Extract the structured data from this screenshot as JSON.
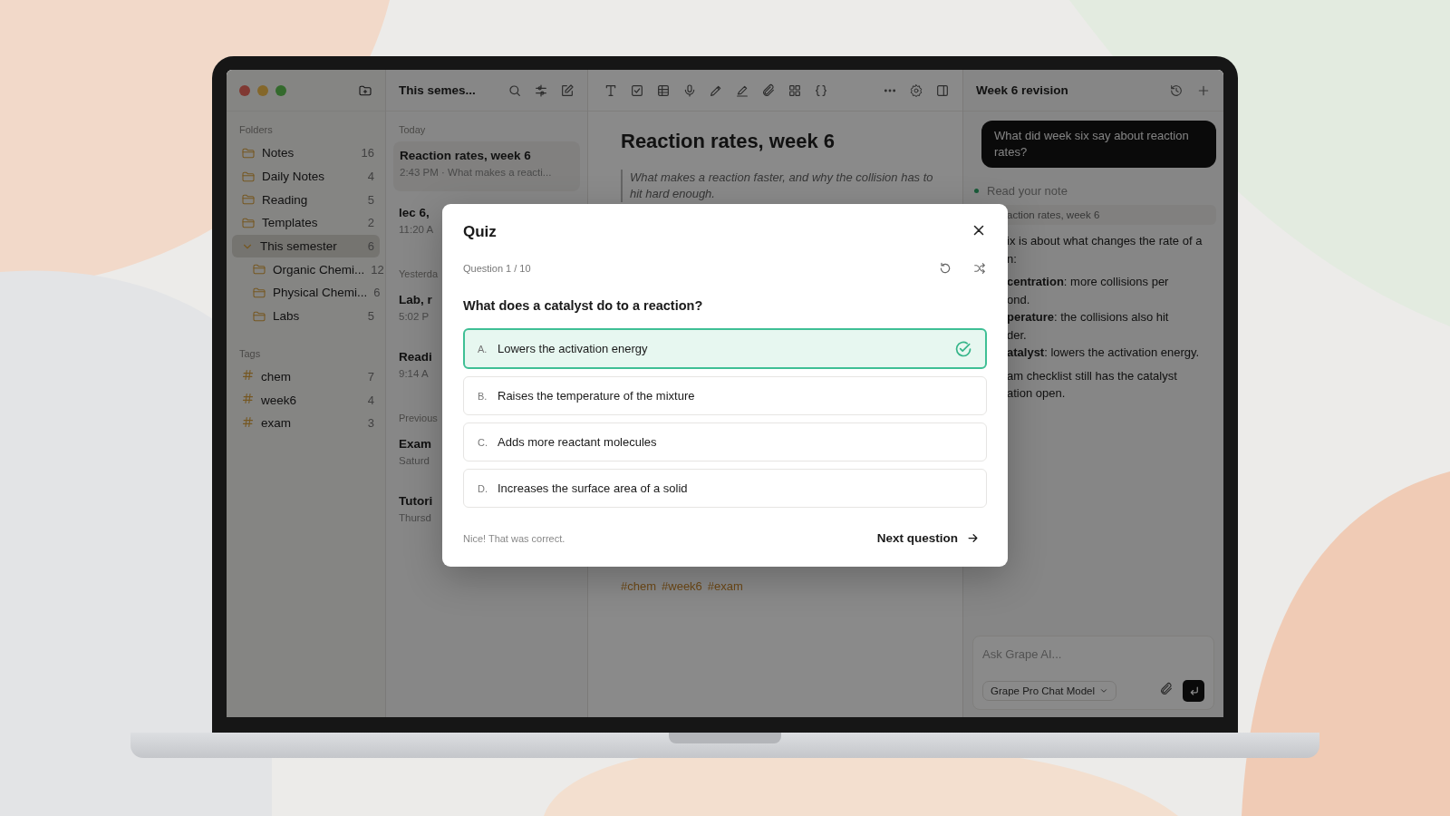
{
  "sidebar": {
    "folders_heading": "Folders",
    "folders": [
      {
        "name": "Notes",
        "count": "16",
        "selected": false
      },
      {
        "name": "Daily Notes",
        "count": "4",
        "selected": false
      },
      {
        "name": "Reading",
        "count": "5",
        "selected": false
      },
      {
        "name": "Templates",
        "count": "2",
        "selected": false
      },
      {
        "name": "This semester",
        "count": "6",
        "selected": true,
        "expanded": true,
        "children": [
          {
            "name": "Organic Chemi...",
            "count": "12",
            "selected": false
          },
          {
            "name": "Physical Chemi...",
            "count": "6",
            "selected": false
          },
          {
            "name": "Labs",
            "count": "5",
            "selected": false
          }
        ]
      }
    ],
    "tags_heading": "Tags",
    "tags": [
      {
        "name": "chem",
        "count": "7"
      },
      {
        "name": "week6",
        "count": "4"
      },
      {
        "name": "exam",
        "count": "3"
      }
    ]
  },
  "note_list": {
    "title": "This semes...",
    "groups": [
      {
        "heading": "Today",
        "notes": [
          {
            "title": "Reaction rates, week 6",
            "meta": "2:43 PM · What makes a reacti...",
            "selected": true
          },
          {
            "title": "lec 6,",
            "meta": "11:20 A",
            "selected": false
          }
        ]
      },
      {
        "heading": "Yesterda",
        "notes": [
          {
            "title": "Lab, r",
            "meta": "5:02 P",
            "selected": false
          },
          {
            "title": "Readi",
            "meta": "9:14 A",
            "selected": false
          }
        ]
      },
      {
        "heading": "Previous",
        "notes": [
          {
            "title": "Exam",
            "meta": "Saturd",
            "selected": false
          },
          {
            "title": "Tutori",
            "meta": "Thursd",
            "selected": false
          }
        ]
      }
    ]
  },
  "editor": {
    "title": "Reaction rates, week 6",
    "quote": "What makes a reaction faster, and why the collision has to hit hard enough.",
    "tags": [
      "#chem",
      "#week6",
      "#exam"
    ]
  },
  "assistant": {
    "title": "Week 6 revision",
    "user_message": "What did week six say about reaction rates?",
    "status": "Read your note",
    "source": "action rates, week 6",
    "paragraphs": [
      {
        "lines": [
          "ix is about what changes the rate of a",
          "n:"
        ]
      },
      {
        "lines": [
          "**centration**: more collisions per",
          "ond.",
          "**perature**: the collisions also hit",
          "der.",
          "**atalyst**: lowers the activation energy."
        ]
      },
      {
        "lines": [
          "am checklist still has the catalyst",
          "ation open."
        ]
      }
    ],
    "input": {
      "placeholder": "Ask Grape AI..."
    },
    "model": "Grape Pro Chat Model"
  },
  "quiz": {
    "title": "Quiz",
    "progress": "Question 1 / 10",
    "question": "What does a catalyst do to a reaction?",
    "options": [
      {
        "letter": "A.",
        "text": "Lowers the activation energy",
        "selected": true,
        "correct": true
      },
      {
        "letter": "B.",
        "text": "Raises the temperature of the mixture",
        "selected": false,
        "correct": false
      },
      {
        "letter": "C.",
        "text": "Adds more reactant molecules",
        "selected": false,
        "correct": false
      },
      {
        "letter": "D.",
        "text": "Increases the surface area of a solid",
        "selected": false,
        "correct": false
      }
    ],
    "feedback": "Nice! That was correct.",
    "next": "Next question"
  }
}
